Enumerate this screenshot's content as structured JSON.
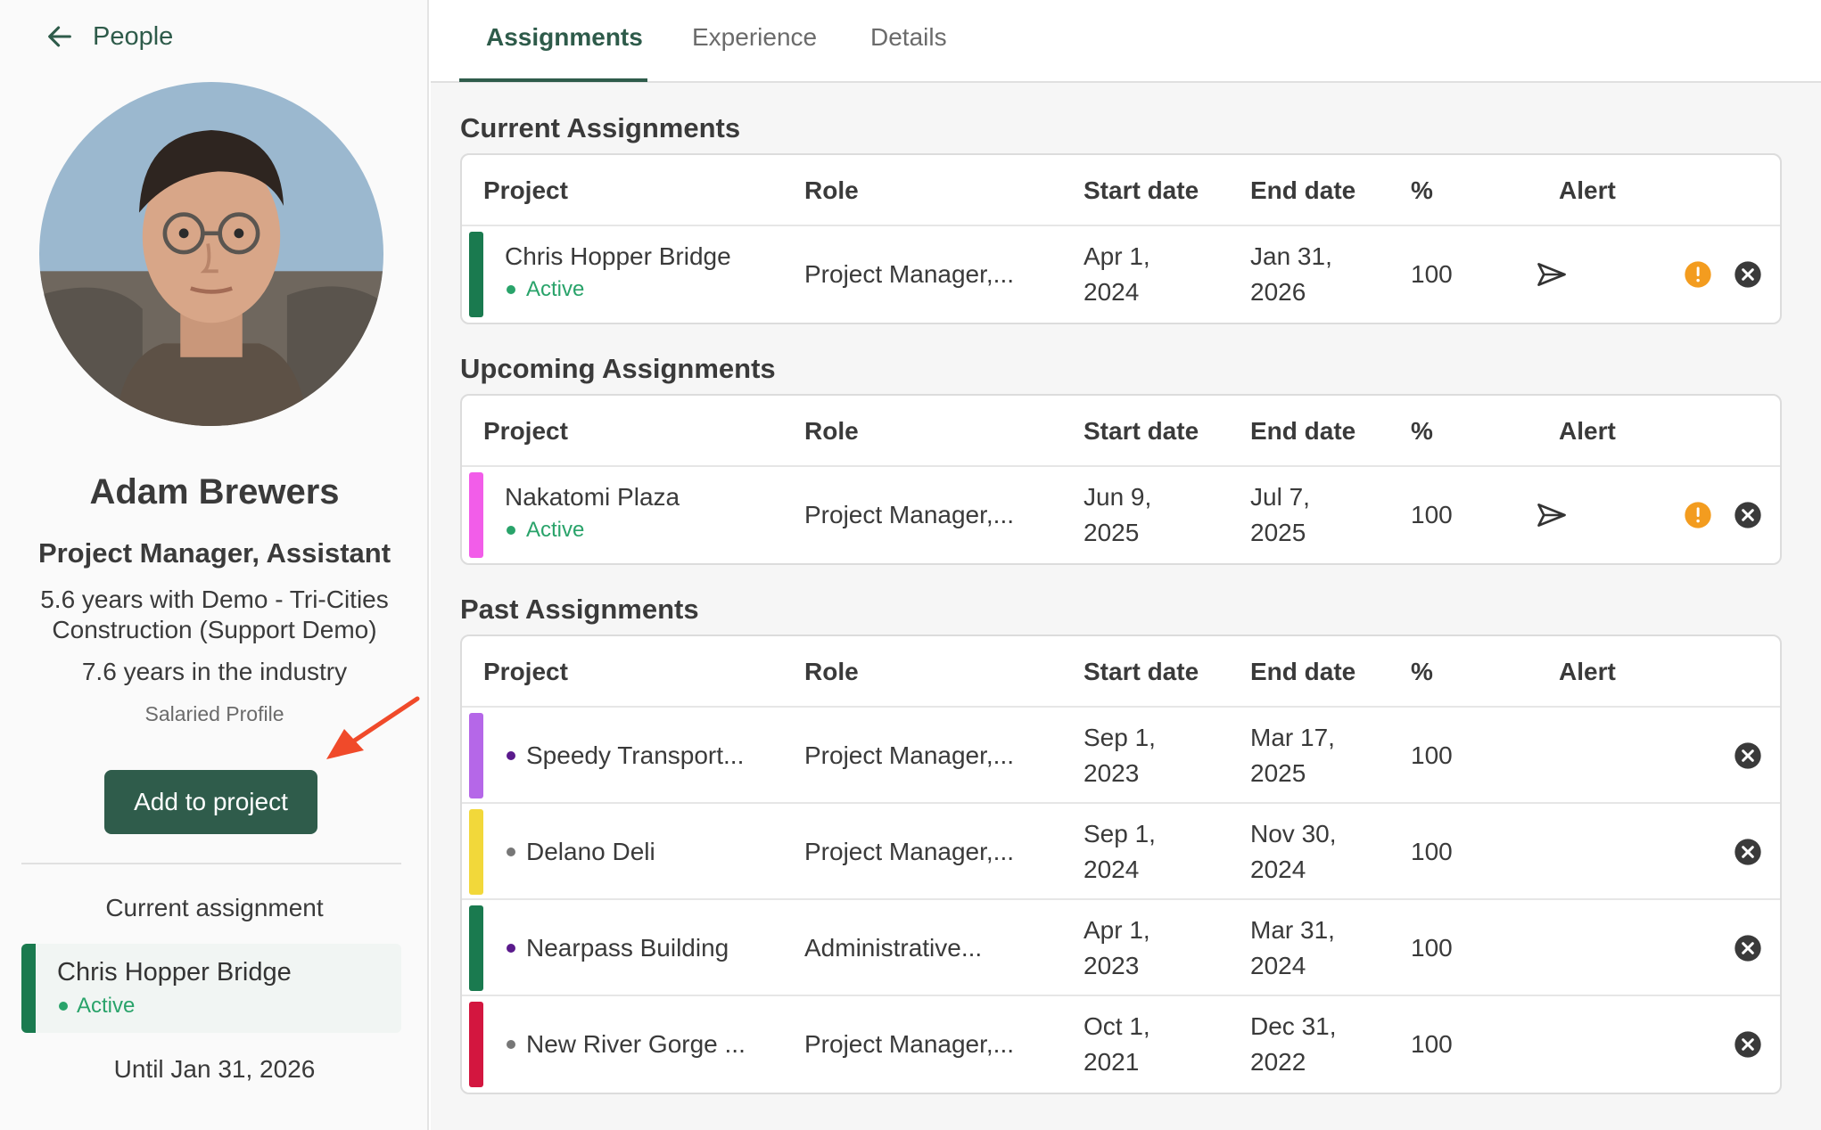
{
  "sidebar": {
    "back_label": "People",
    "person": {
      "name": "Adam Brewers",
      "title": "Project Manager, Assistant",
      "tenure": "5.6 years with Demo - Tri-Cities Construction (Support Demo)",
      "industry": "7.6 years in the industry",
      "profile_type": "Salaried Profile"
    },
    "add_button_label": "Add to project",
    "current_assignment": {
      "heading": "Current assignment",
      "project": "Chris Hopper Bridge",
      "status": "Active",
      "until": "Until Jan 31, 2026",
      "color": "#1a7a4f"
    }
  },
  "tabs": [
    {
      "label": "Assignments",
      "active": true
    },
    {
      "label": "Experience",
      "active": false
    },
    {
      "label": "Details",
      "active": false
    }
  ],
  "columns": {
    "project": "Project",
    "role": "Role",
    "start": "Start date",
    "end": "End date",
    "pct": "%",
    "alert": "Alert"
  },
  "current": {
    "title": "Current Assignments",
    "rows": [
      {
        "project": "Chris Hopper Bridge",
        "status": "Active",
        "role": "Project Manager,...",
        "start_1": "Apr 1,",
        "start_2": "2024",
        "end_1": "Jan 31,",
        "end_2": "2026",
        "pct": "100",
        "color": "#1a7a4f"
      }
    ]
  },
  "upcoming": {
    "title": "Upcoming Assignments",
    "rows": [
      {
        "project": "Nakatomi Plaza",
        "status": "Active",
        "role": "Project Manager,...",
        "start_1": "Jun 9,",
        "start_2": "2025",
        "end_1": "Jul 7,",
        "end_2": "2025",
        "pct": "100",
        "color": "#f25de9"
      }
    ]
  },
  "past": {
    "title": "Past Assignments",
    "rows": [
      {
        "project": "Speedy Transport...",
        "role": "Project Manager,...",
        "start_1": "Sep 1,",
        "start_2": "2023",
        "end_1": "Mar 17,",
        "end_2": "2025",
        "pct": "100",
        "color": "#b567e8",
        "dot": "#5a1a8c"
      },
      {
        "project": "Delano Deli",
        "role": "Project Manager,...",
        "start_1": "Sep 1,",
        "start_2": "2024",
        "end_1": "Nov 30,",
        "end_2": "2024",
        "pct": "100",
        "color": "#f2d83a",
        "dot": "#777777"
      },
      {
        "project": "Nearpass Building",
        "role": "Administrative...",
        "start_1": "Apr 1,",
        "start_2": "2023",
        "end_1": "Mar 31,",
        "end_2": "2024",
        "pct": "100",
        "color": "#1a7a4f",
        "dot": "#5a1a8c"
      },
      {
        "project": "New River Gorge ...",
        "role": "Project Manager,...",
        "start_1": "Oct 1,",
        "start_2": "2021",
        "end_1": "Dec 31,",
        "end_2": "2022",
        "pct": "100",
        "color": "#d3163f",
        "dot": "#777777"
      }
    ]
  }
}
